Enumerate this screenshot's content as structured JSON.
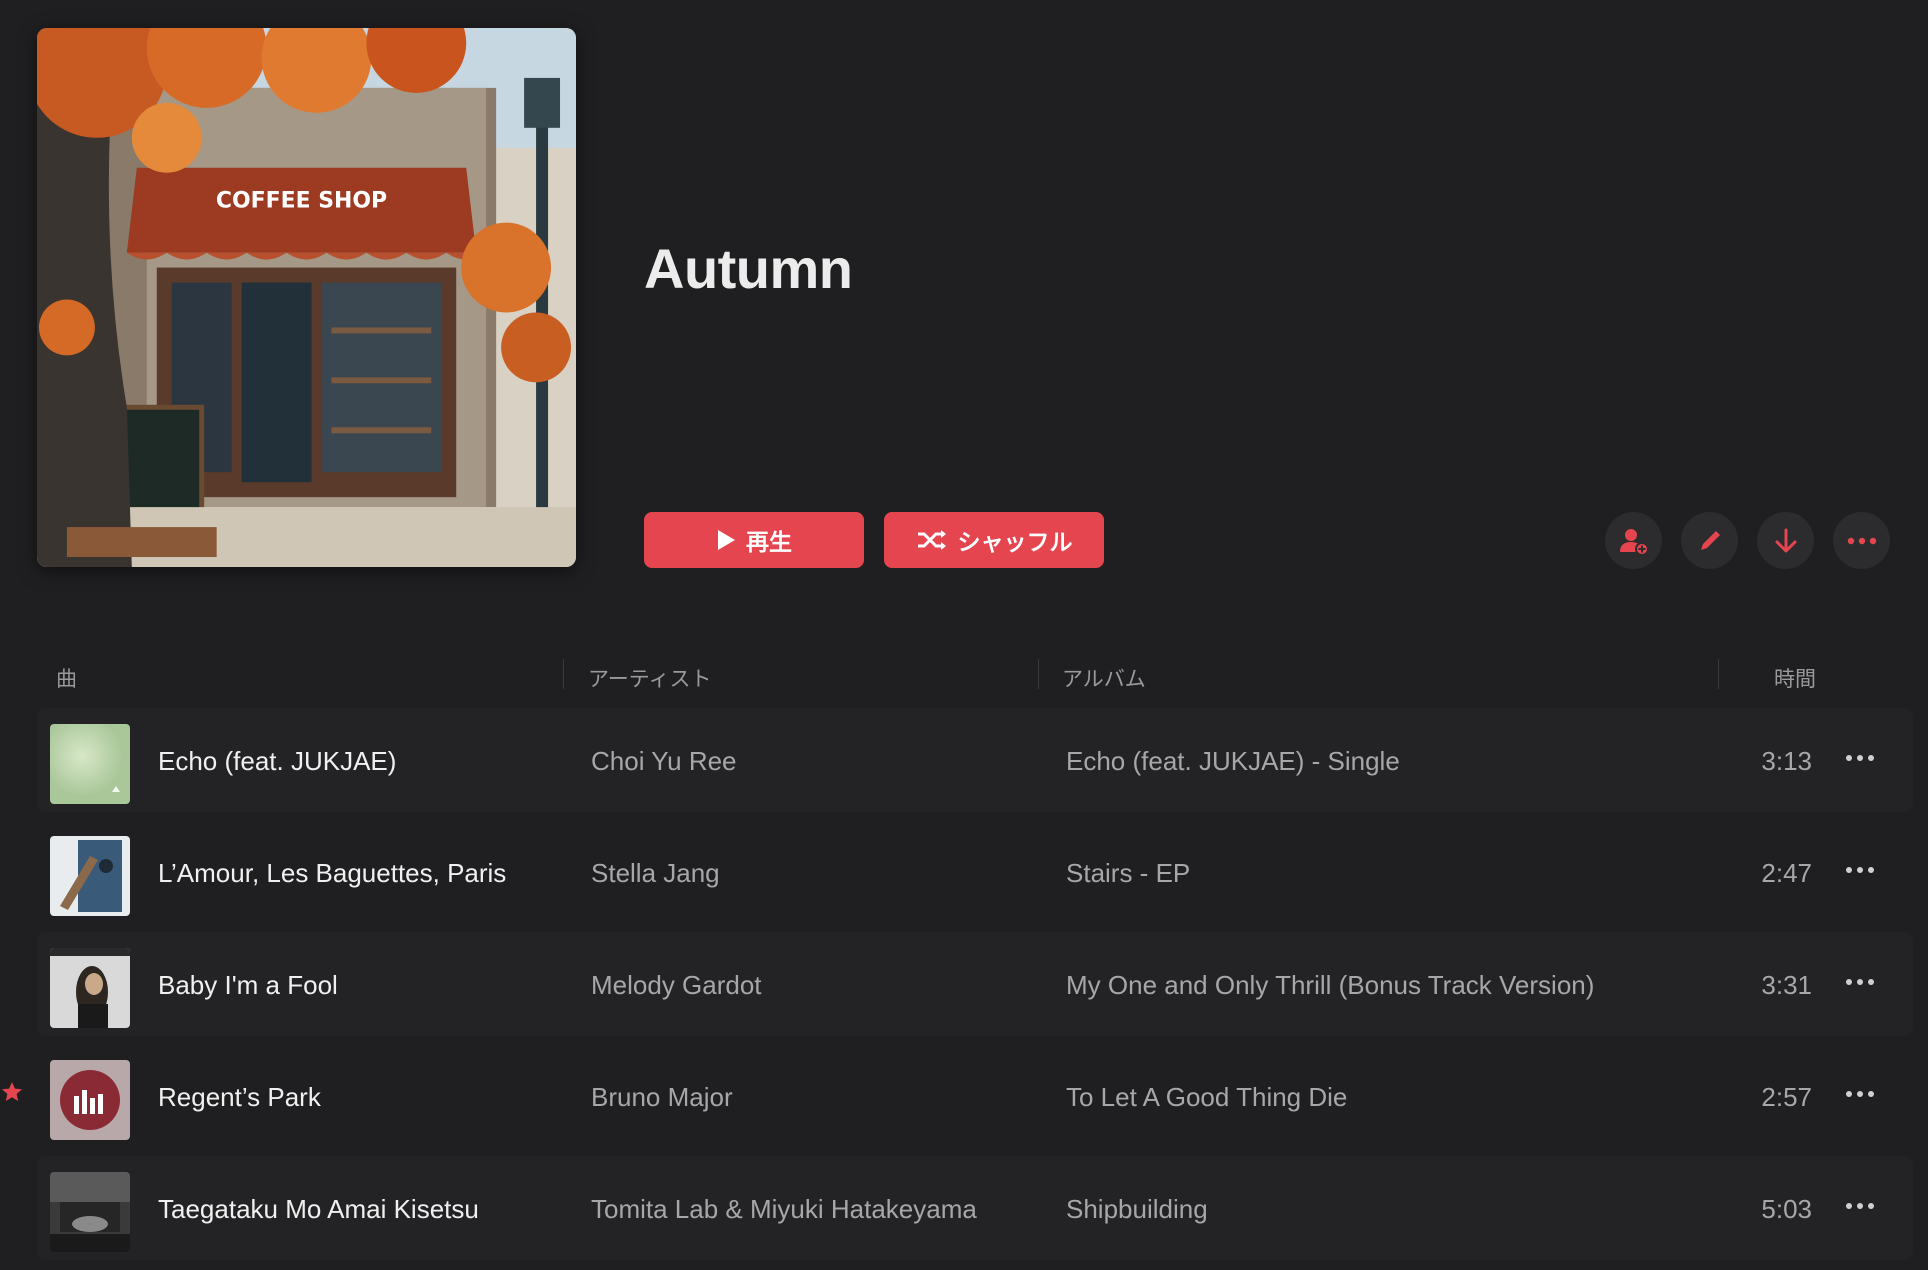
{
  "playlist": {
    "title": "Autumn",
    "cover_sign_text": "COFFEE SHOP"
  },
  "actions": {
    "play_label": "再生",
    "shuffle_label": "シャッフル",
    "icons": [
      "add-collaborator-icon",
      "edit-icon",
      "download-icon",
      "more-icon"
    ],
    "accent_color": "#e5454f"
  },
  "table": {
    "headers": {
      "song": "曲",
      "artist": "アーティスト",
      "album": "アルバム",
      "time": "時間"
    },
    "tracks": [
      {
        "title": "Echo (feat. JUKJAE)",
        "artist": "Choi Yu Ree",
        "album": "Echo (feat. JUKJAE) - Single",
        "duration": "3:13",
        "favorite": false
      },
      {
        "title": "L’Amour, Les Baguettes, Paris",
        "artist": "Stella Jang",
        "album": "Stairs - EP",
        "duration": "2:47",
        "favorite": false
      },
      {
        "title": "Baby I'm a Fool",
        "artist": "Melody Gardot",
        "album": "My One and Only Thrill (Bonus Track Version)",
        "duration": "3:31",
        "favorite": false
      },
      {
        "title": "Regent’s Park",
        "artist": "Bruno Major",
        "album": "To Let A Good Thing Die",
        "duration": "2:57",
        "favorite": true
      },
      {
        "title": "Taegataku Mo Amai Kisetsu",
        "artist": "Tomita Lab & Miyuki Hatakeyama",
        "album": "Shipbuilding",
        "duration": "5:03",
        "favorite": false
      }
    ]
  }
}
